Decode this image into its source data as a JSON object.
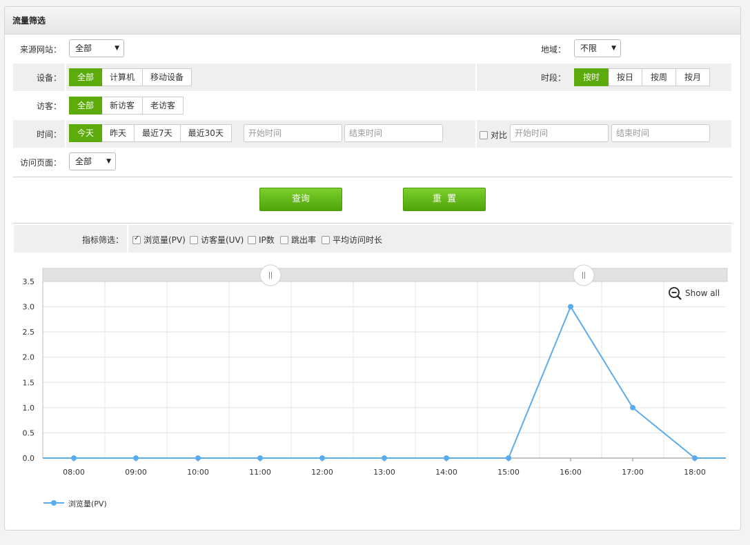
{
  "panel": {
    "title": "流量筛选"
  },
  "filters": {
    "source": {
      "label": "来源网站：",
      "value": "全部"
    },
    "region": {
      "label": "地域：",
      "value": "不限"
    },
    "device": {
      "label": "设备：",
      "options": [
        "全部",
        "计算机",
        "移动设备"
      ],
      "selected": 0
    },
    "period": {
      "label": "时段：",
      "options": [
        "按时",
        "按日",
        "按周",
        "按月"
      ],
      "selected": 0
    },
    "visitor": {
      "label": "访客：",
      "options": [
        "全部",
        "新访客",
        "老访客"
      ],
      "selected": 0
    },
    "time": {
      "label": "时间：",
      "options": [
        "今天",
        "昨天",
        "最近7天",
        "最近30天"
      ],
      "selected": 0,
      "start_placeholder": "开始时间",
      "end_placeholder": "结束时间"
    },
    "compare": {
      "label": "对比",
      "checked": false,
      "start_placeholder": "开始时间",
      "end_placeholder": "结束时间"
    },
    "page": {
      "label": "访问页面：",
      "value": "全部"
    }
  },
  "actions": {
    "query_label": "查询",
    "reset_label": "重  置"
  },
  "metrics": {
    "label": "指标筛选：",
    "items": [
      {
        "label": "浏览量(PV)",
        "checked": true
      },
      {
        "label": "访客量(UV)",
        "checked": false
      },
      {
        "label": "IP数",
        "checked": false
      },
      {
        "label": "跳出率",
        "checked": false
      },
      {
        "label": "平均访问时长",
        "checked": false
      }
    ]
  },
  "chart": {
    "show_all_label": "Show all",
    "zoom_icon": "zoom-out-icon"
  },
  "chart_data": {
    "type": "line",
    "x": [
      "08:00",
      "09:00",
      "10:00",
      "11:00",
      "12:00",
      "13:00",
      "14:00",
      "15:00",
      "16:00",
      "17:00",
      "18:00"
    ],
    "series": [
      {
        "name": "浏览量(PV)",
        "values": [
          0,
          0,
          0,
          0,
          0,
          0,
          0,
          0,
          3,
          1,
          0
        ],
        "color": "#5aacee"
      }
    ],
    "yticks": [
      "0.0",
      "0.5",
      "1.0",
      "1.5",
      "2.0",
      "2.5",
      "3.0",
      "3.5"
    ],
    "ylim": [
      0,
      3.5
    ],
    "grid": true,
    "legend": "bottom-left"
  }
}
